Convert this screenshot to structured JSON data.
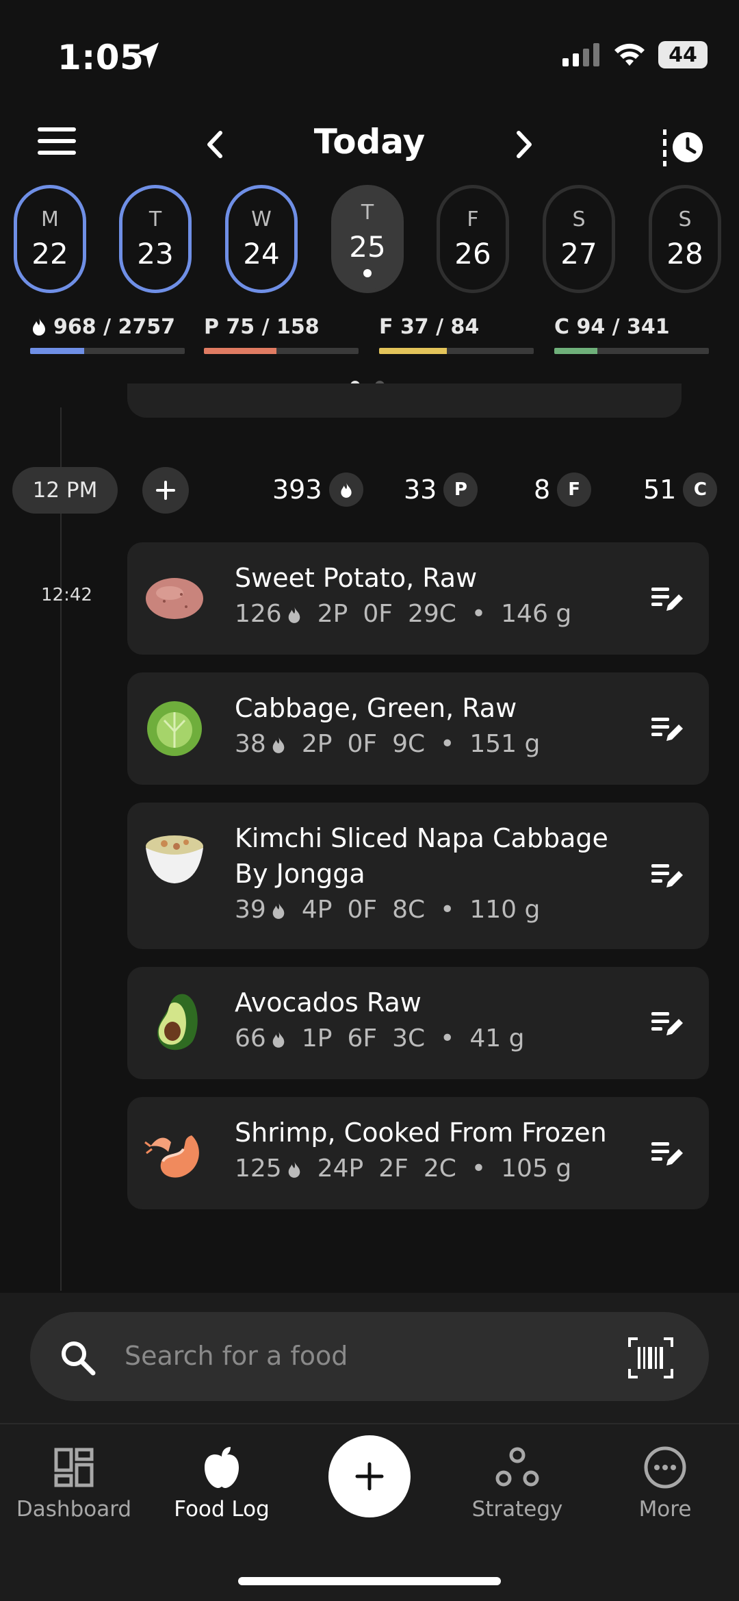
{
  "status": {
    "time": "1:05",
    "battery": "44"
  },
  "header": {
    "title": "Today"
  },
  "days": [
    {
      "wk": "M",
      "dn": "22",
      "state": "done"
    },
    {
      "wk": "T",
      "dn": "23",
      "state": "done"
    },
    {
      "wk": "W",
      "dn": "24",
      "state": "done"
    },
    {
      "wk": "T",
      "dn": "25",
      "state": "today"
    },
    {
      "wk": "F",
      "dn": "26",
      "state": "future"
    },
    {
      "wk": "S",
      "dn": "27",
      "state": "future"
    },
    {
      "wk": "S",
      "dn": "28",
      "state": "future"
    }
  ],
  "summary": {
    "calories": {
      "text": "968 / 2757",
      "progress": 0.35,
      "color": "#6f8fe6"
    },
    "protein": {
      "text": "P 75 / 158",
      "progress": 0.47,
      "color": "#e07b62"
    },
    "fat": {
      "text": "F 37 / 84",
      "progress": 0.44,
      "color": "#e3c45a"
    },
    "carbs": {
      "text": "C 94 / 341",
      "progress": 0.28,
      "color": "#6fb07a"
    }
  },
  "meal": {
    "time_label": "12 PM",
    "calories": "393",
    "protein": "33",
    "fat": "8",
    "carbs": "51",
    "badge_p": "P",
    "badge_f": "F",
    "badge_c": "C",
    "entry_time": "12:42"
  },
  "foods": [
    {
      "name": "Sweet Potato, Raw",
      "cal": "126",
      "p": "2P",
      "f": "0F",
      "c": "29C",
      "w": "146 g",
      "icon": "sweet-potato-icon"
    },
    {
      "name": "Cabbage, Green, Raw",
      "cal": "38",
      "p": "2P",
      "f": "0F",
      "c": "9C",
      "w": "151 g",
      "icon": "cabbage-icon"
    },
    {
      "name1": "Kimchi Sliced Napa Cabbage",
      "name2": "By Jongga",
      "cal": "39",
      "p": "4P",
      "f": "0F",
      "c": "8C",
      "w": "110 g",
      "icon": "kimchi-bowl-icon"
    },
    {
      "name": "Avocados Raw",
      "cal": "66",
      "p": "1P",
      "f": "6F",
      "c": "3C",
      "w": "41 g",
      "icon": "avocado-icon"
    },
    {
      "name": "Shrimp, Cooked From Frozen",
      "cal": "125",
      "p": "24P",
      "f": "2F",
      "c": "2C",
      "w": "105 g",
      "icon": "shrimp-icon"
    }
  ],
  "search": {
    "placeholder": "Search for a food"
  },
  "tabs": {
    "dashboard": "Dashboard",
    "food_log": "Food Log",
    "strategy": "Strategy",
    "more": "More"
  },
  "separator": "•"
}
